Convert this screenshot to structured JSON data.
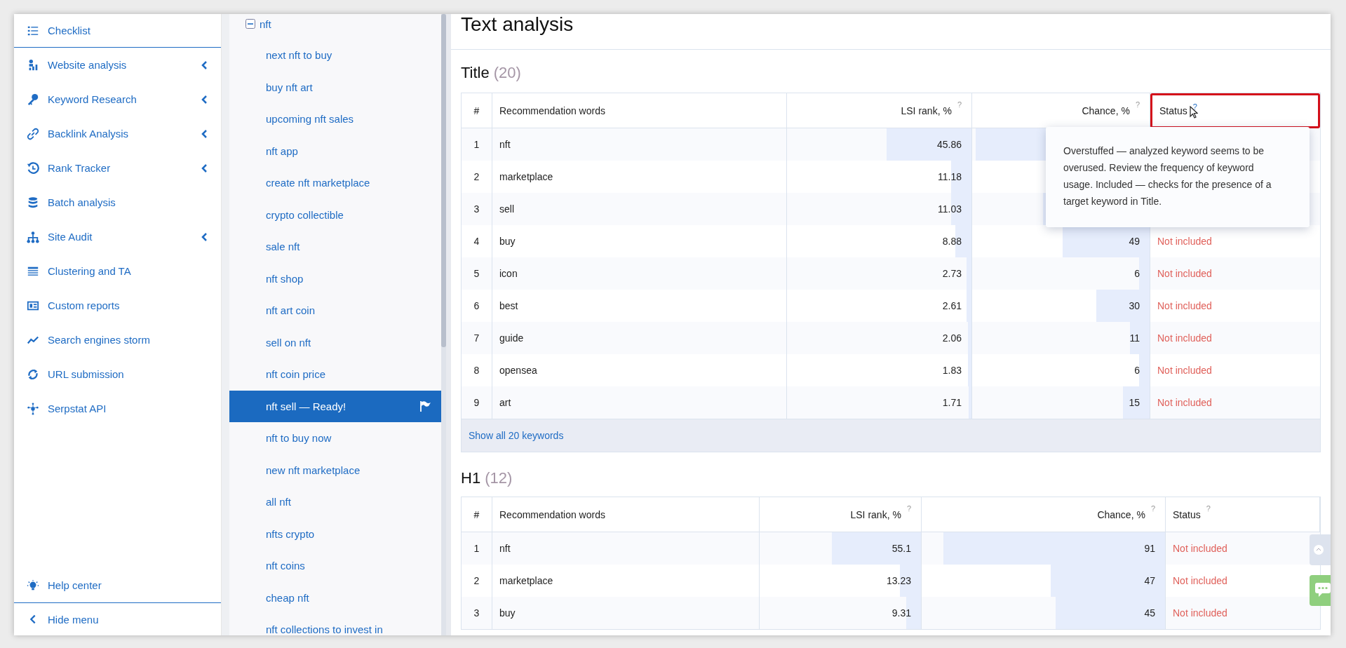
{
  "sidebar": {
    "items": [
      {
        "label": "Checklist",
        "expandable": false
      },
      {
        "label": "Website analysis",
        "expandable": true
      },
      {
        "label": "Keyword Research",
        "expandable": true
      },
      {
        "label": "Backlink Analysis",
        "expandable": true
      },
      {
        "label": "Rank Tracker",
        "expandable": true
      },
      {
        "label": "Batch analysis",
        "expandable": false
      },
      {
        "label": "Site Audit",
        "expandable": true
      },
      {
        "label": "Clustering and TA",
        "expandable": false
      },
      {
        "label": "Custom reports",
        "expandable": false
      },
      {
        "label": "Search engines storm",
        "expandable": false
      },
      {
        "label": "URL submission",
        "expandable": false
      },
      {
        "label": "Serpstat API",
        "expandable": false
      }
    ],
    "footer": [
      {
        "label": "Help center"
      },
      {
        "label": "Hide menu"
      }
    ]
  },
  "keyword_tree": {
    "label": "nft",
    "expanded": true,
    "children": [
      {
        "label": "next nft to buy",
        "selected": false
      },
      {
        "label": "buy nft art",
        "selected": false
      },
      {
        "label": "upcoming nft sales",
        "selected": false
      },
      {
        "label": "nft app",
        "selected": false
      },
      {
        "label": "create nft marketplace",
        "selected": false
      },
      {
        "label": "crypto collectible",
        "selected": false
      },
      {
        "label": "sale nft",
        "selected": false
      },
      {
        "label": "nft shop",
        "selected": false
      },
      {
        "label": "nft art coin",
        "selected": false
      },
      {
        "label": "sell on nft",
        "selected": false
      },
      {
        "label": "nft coin price",
        "selected": false
      },
      {
        "label": "nft sell — Ready!",
        "selected": true,
        "flagged": true
      },
      {
        "label": "nft to buy now",
        "selected": false
      },
      {
        "label": "new nft marketplace",
        "selected": false
      },
      {
        "label": "all nft",
        "selected": false
      },
      {
        "label": "nfts crypto",
        "selected": false
      },
      {
        "label": "nft coins",
        "selected": false
      },
      {
        "label": "cheap nft",
        "selected": false
      },
      {
        "label": "nft collections to invest in",
        "selected": false
      }
    ]
  },
  "page_title": "Text analysis",
  "sections": [
    {
      "title": "Title",
      "count": "(20)",
      "columns": [
        {
          "label": "#"
        },
        {
          "label": "Recommendation words"
        },
        {
          "label": "LSI rank, %",
          "help": "?",
          "help_active": false,
          "highlighted": false
        },
        {
          "label": "Chance, %",
          "help": "?",
          "help_active": false,
          "highlighted": false
        },
        {
          "label": "Status",
          "help": "?",
          "help_active": true,
          "highlighted": true
        }
      ],
      "tooltip": "Overstuffed — analyzed keyword seems to be overused. Review the frequency of keyword usage. Included — checks for the presence of a target keyword in Title.",
      "rows": [
        {
          "n": "1",
          "word": "nft",
          "lsi": {
            "text": "45.86",
            "level": 0.4586
          },
          "chance": {
            "level": 0.98
          }
        },
        {
          "n": "2",
          "word": "marketplace",
          "lsi": {
            "text": "11.18",
            "level": 0.1118
          }
        },
        {
          "n": "3",
          "word": "sell",
          "lsi": {
            "text": "11.03",
            "level": 0.1103
          },
          "chance": {
            "level": 0.6
          }
        },
        {
          "n": "4",
          "word": "buy",
          "lsi": {
            "text": "8.88",
            "level": 0.0888
          },
          "chance": {
            "text": "49",
            "level": 0.49
          },
          "status": {
            "text": "Not included",
            "kind": "not_included"
          }
        },
        {
          "n": "5",
          "word": "icon",
          "lsi": {
            "text": "2.73",
            "level": 0.0273
          },
          "chance": {
            "text": "6",
            "level": 0.06
          },
          "status": {
            "text": "Not included",
            "kind": "not_included"
          }
        },
        {
          "n": "6",
          "word": "best",
          "lsi": {
            "text": "2.61",
            "level": 0.0261
          },
          "chance": {
            "text": "30",
            "level": 0.3
          },
          "status": {
            "text": "Not included",
            "kind": "not_included"
          }
        },
        {
          "n": "7",
          "word": "guide",
          "lsi": {
            "text": "2.06",
            "level": 0.0206
          },
          "chance": {
            "text": "11",
            "level": 0.11
          },
          "status": {
            "text": "Not included",
            "kind": "not_included"
          }
        },
        {
          "n": "8",
          "word": "opensea",
          "lsi": {
            "text": "1.83",
            "level": 0.0183
          },
          "chance": {
            "text": "6",
            "level": 0.06
          },
          "status": {
            "text": "Not included",
            "kind": "not_included"
          }
        },
        {
          "n": "9",
          "word": "art",
          "lsi": {
            "text": "1.71",
            "level": 0.0171
          },
          "chance": {
            "text": "15",
            "level": 0.15
          },
          "status": {
            "text": "Not included",
            "kind": "not_included"
          }
        }
      ],
      "show_all": "Show all 20 keywords"
    },
    {
      "title": "H1",
      "count": "(12)",
      "columns": [
        {
          "label": "#"
        },
        {
          "label": "Recommendation words"
        },
        {
          "label": "LSI rank, %",
          "help": "?",
          "help_active": false,
          "highlighted": false
        },
        {
          "label": "Chance, %",
          "help": "?",
          "help_active": false,
          "highlighted": false
        },
        {
          "label": "Status",
          "help": "?",
          "help_active": false,
          "highlighted": false
        }
      ],
      "rows": [
        {
          "n": "1",
          "word": "nft",
          "lsi": {
            "text": "55.1",
            "level": 0.551
          },
          "chance": {
            "text": "91",
            "level": 0.91
          },
          "status": {
            "text": "Not included",
            "kind": "not_included"
          }
        },
        {
          "n": "2",
          "word": "marketplace",
          "lsi": {
            "text": "13.23",
            "level": 0.1323
          },
          "chance": {
            "text": "47",
            "level": 0.47
          },
          "status": {
            "text": "Not included",
            "kind": "not_included"
          }
        },
        {
          "n": "3",
          "word": "buy",
          "lsi": {
            "text": "9.31",
            "level": 0.0931
          },
          "chance": {
            "text": "45",
            "level": 0.45
          },
          "status": {
            "text": "Not included",
            "kind": "not_included"
          }
        }
      ]
    }
  ]
}
